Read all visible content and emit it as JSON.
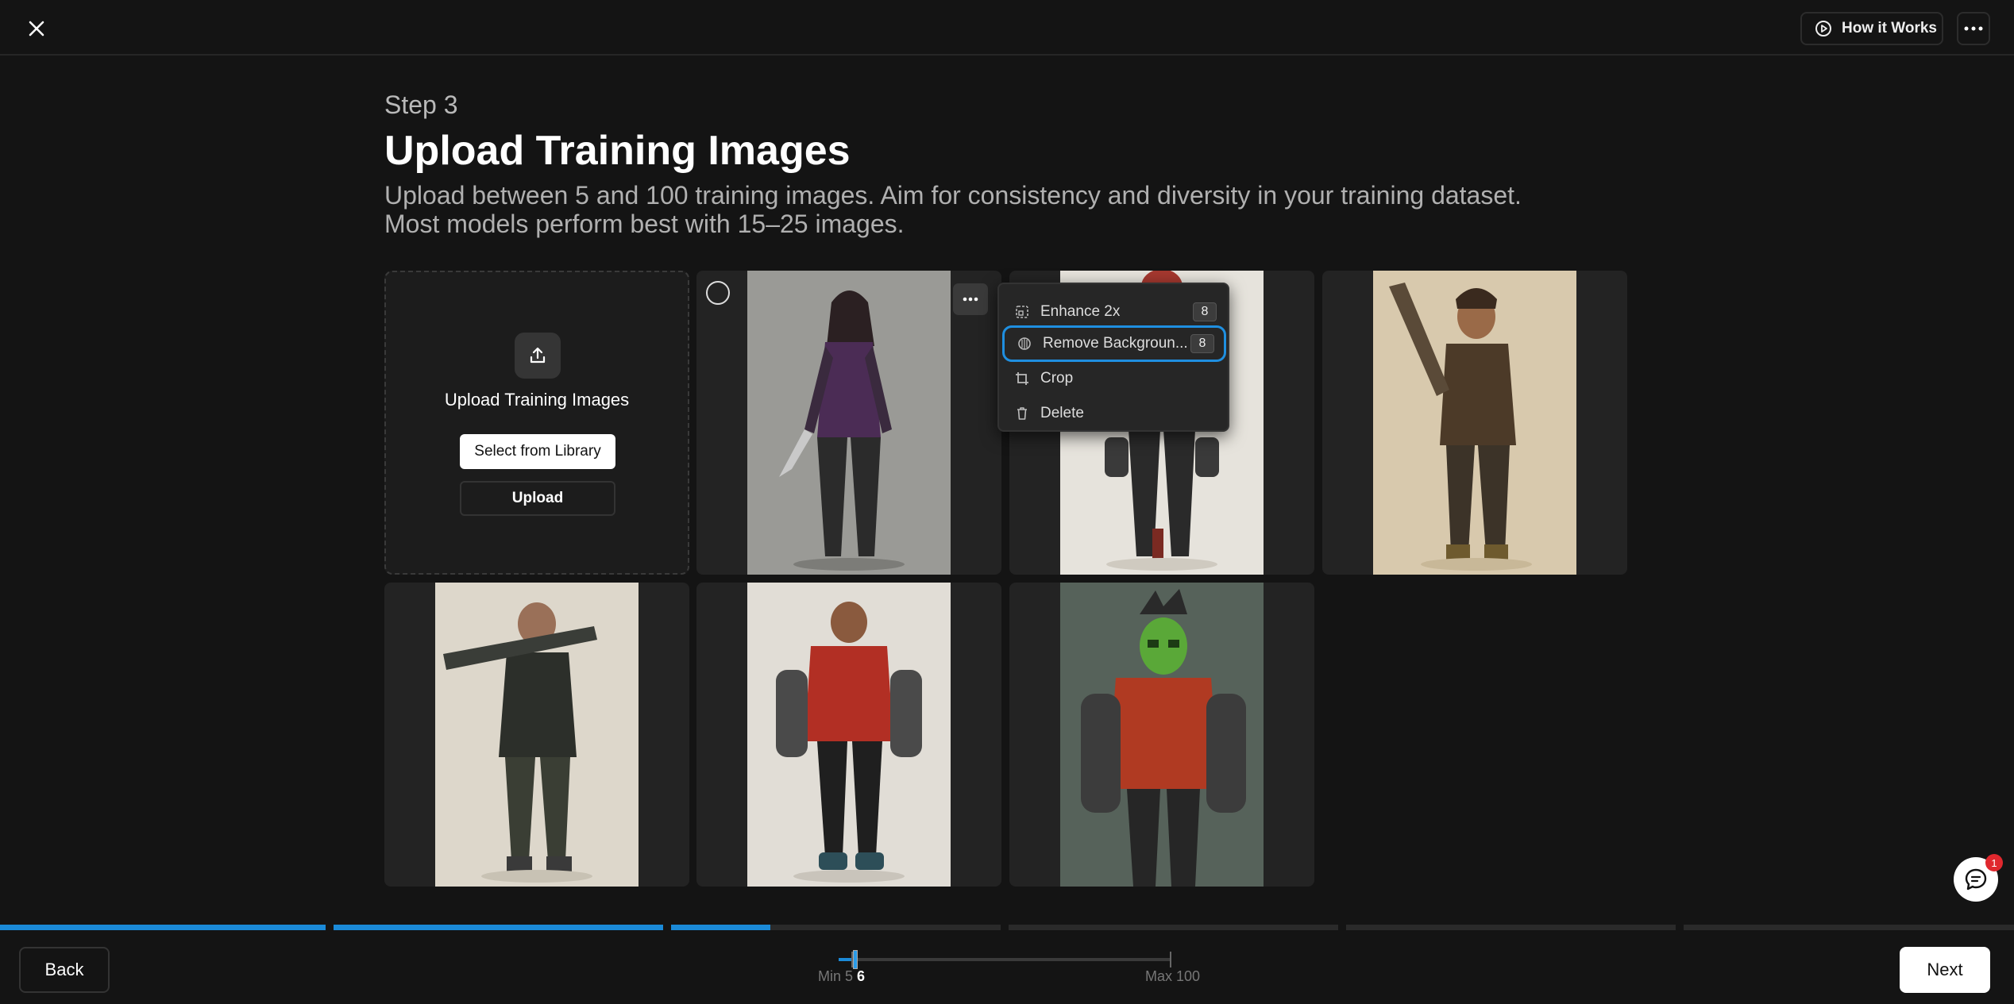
{
  "header": {
    "how_it_works_label": "How it Works"
  },
  "page": {
    "step_label": "Step 3",
    "title": "Upload Training Images",
    "description_line1": "Upload between 5 and 100 training images. Aim for consistency and diversity in your training dataset.",
    "description_line2": "Most models perform best with 15–25 images."
  },
  "upload_card": {
    "title": "Upload Training Images",
    "select_library_label": "Select from Library",
    "upload_label": "Upload"
  },
  "images": [
    {
      "subject": "woman in purple armor with knife",
      "bg": "#9a9a96"
    },
    {
      "subject": "man in red with gauntlets",
      "bg": "#e6e3dc"
    },
    {
      "subject": "bearded man with rifle, brown jacket",
      "bg": "#d8c9ad"
    },
    {
      "subject": "man with rocket launcher, black jacket",
      "bg": "#ddd7cb"
    },
    {
      "subject": "man in red hoodie with robotic arms",
      "bg": "#e1ddd6"
    },
    {
      "subject": "green skull mask, red hoodie",
      "bg": "#5e6a62"
    }
  ],
  "context_menu": {
    "items": [
      {
        "label": "Enhance 2x",
        "credits": "8"
      },
      {
        "label": "Remove Backgroun...",
        "credits": "8"
      },
      {
        "label": "Crop"
      },
      {
        "label": "Delete"
      }
    ]
  },
  "progress": [
    1,
    1,
    0.3,
    0,
    0,
    0
  ],
  "footer": {
    "back_label": "Back",
    "next_label": "Next",
    "min_label": "Min 5",
    "count": "6",
    "max_label": "Max 100"
  },
  "chat": {
    "badge": "1"
  },
  "colors": {
    "accent": "#1b8ad8",
    "background": "#141414"
  }
}
